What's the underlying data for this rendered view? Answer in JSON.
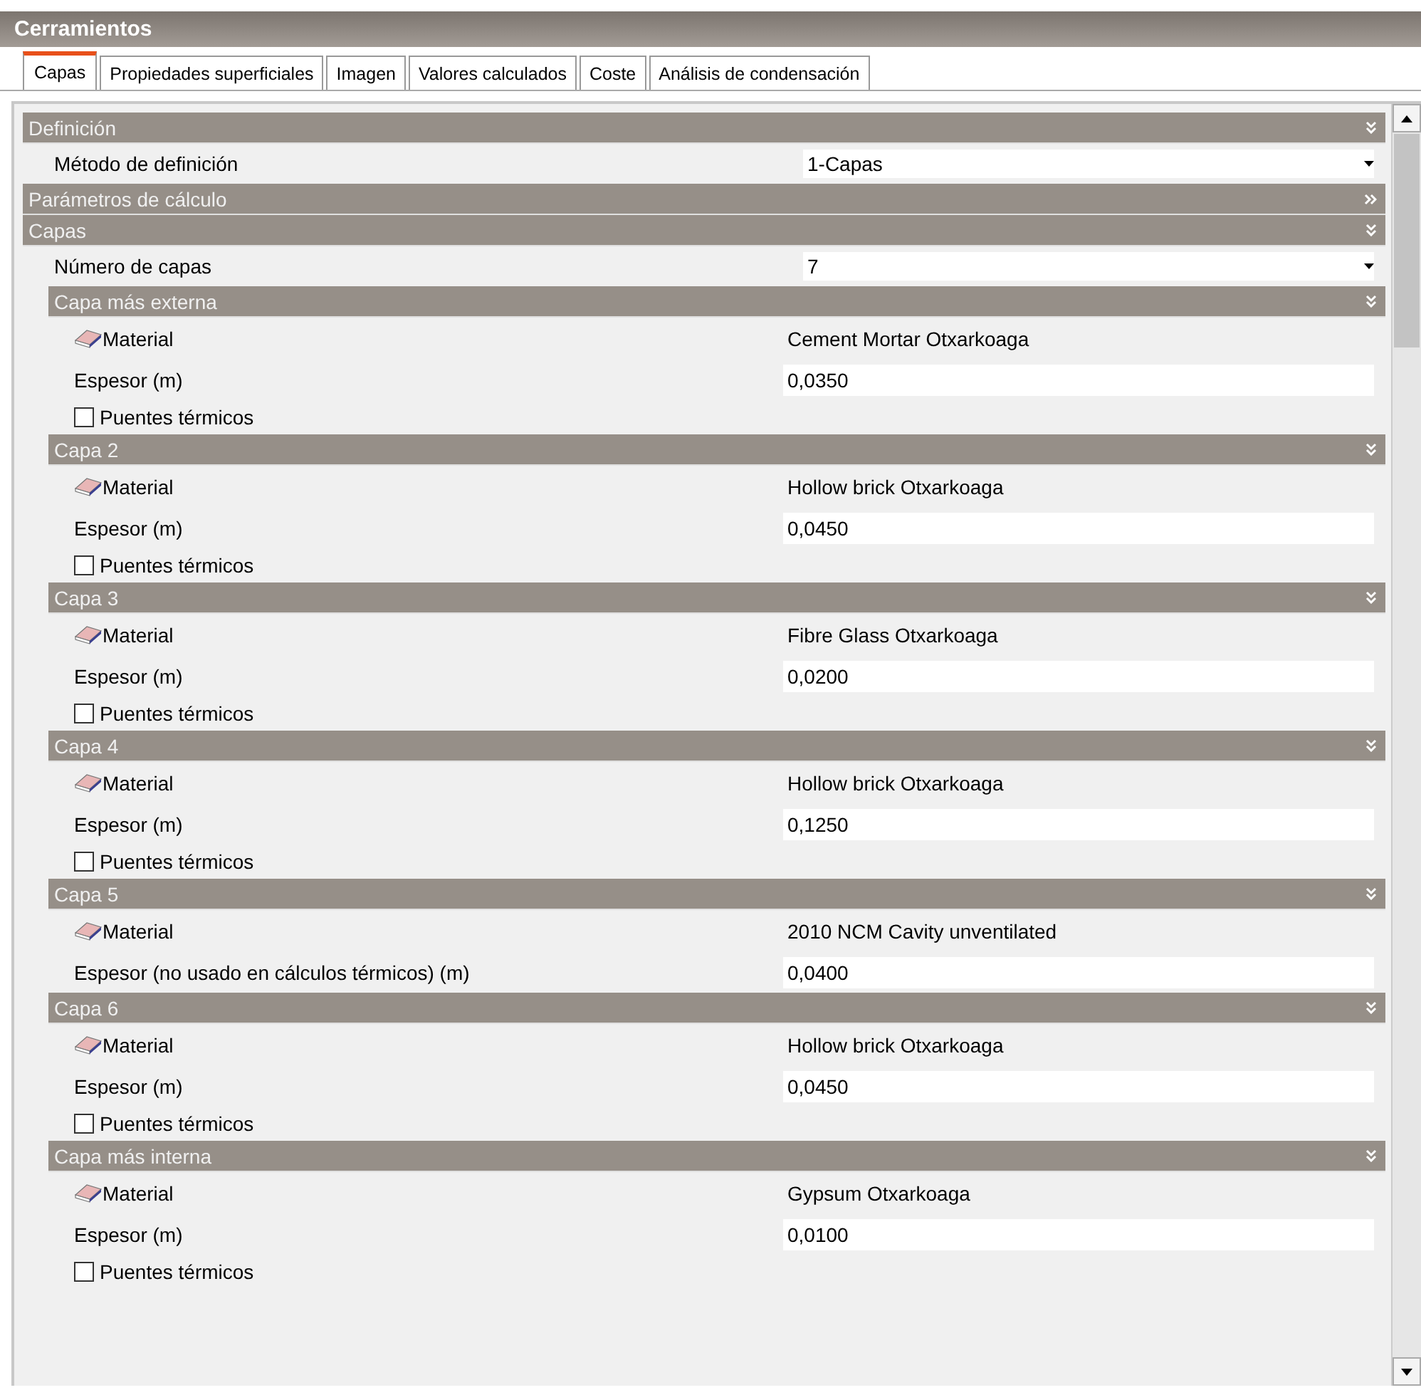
{
  "window": {
    "title": "Cerramientos"
  },
  "tabs": [
    {
      "label": "Capas",
      "selected": true
    },
    {
      "label": "Propiedades superficiales",
      "selected": false
    },
    {
      "label": "Imagen",
      "selected": false
    },
    {
      "label": "Valores calculados",
      "selected": false
    },
    {
      "label": "Coste",
      "selected": false
    },
    {
      "label": "Análisis de condensación",
      "selected": false
    }
  ],
  "sections": [
    {
      "title": "Definición",
      "expanded": true,
      "rows": [
        {
          "label": "Método de definición",
          "value": "1-Capas"
        }
      ]
    },
    {
      "title": "Parámetros de cálculo",
      "expanded": false
    },
    {
      "title": "Capas",
      "expanded": true,
      "rows": [
        {
          "label": "Número de capas",
          "value": "7"
        }
      ],
      "layers": [
        {
          "title": "Capa más externa",
          "expanded": true,
          "material": {
            "label": "Material",
            "value": "Cement Mortar Otxarkoaga"
          },
          "thickness": {
            "label": "Espesor (m)",
            "value": "0,0350"
          },
          "thermal_bridges": {
            "label": "Puentes térmicos",
            "checked": false
          }
        },
        {
          "title": "Capa 2",
          "expanded": true,
          "material": {
            "label": "Material",
            "value": "Hollow brick Otxarkoaga"
          },
          "thickness": {
            "label": "Espesor (m)",
            "value": "0,0450"
          },
          "thermal_bridges": {
            "label": "Puentes térmicos",
            "checked": false
          }
        },
        {
          "title": "Capa 3",
          "expanded": true,
          "material": {
            "label": "Material",
            "value": "Fibre Glass Otxarkoaga"
          },
          "thickness": {
            "label": "Espesor (m)",
            "value": "0,0200"
          },
          "thermal_bridges": {
            "label": "Puentes térmicos",
            "checked": false
          }
        },
        {
          "title": "Capa 4",
          "expanded": true,
          "material": {
            "label": "Material",
            "value": "Hollow brick Otxarkoaga"
          },
          "thickness": {
            "label": "Espesor (m)",
            "value": "0,1250"
          },
          "thermal_bridges": {
            "label": "Puentes térmicos",
            "checked": false
          }
        },
        {
          "title": "Capa 5",
          "expanded": true,
          "material": {
            "label": "Material",
            "value": "2010 NCM Cavity unventilated"
          },
          "thickness": {
            "label": "Espesor (no usado en cálculos térmicos) (m)",
            "value": "0,0400"
          }
        },
        {
          "title": "Capa 6",
          "expanded": true,
          "material": {
            "label": "Material",
            "value": "Hollow brick Otxarkoaga"
          },
          "thickness": {
            "label": "Espesor (m)",
            "value": "0,0450"
          },
          "thermal_bridges": {
            "label": "Puentes térmicos",
            "checked": false
          }
        },
        {
          "title": "Capa más interna",
          "expanded": true,
          "material": {
            "label": "Material",
            "value": "Gypsum Otxarkoaga"
          },
          "thickness": {
            "label": "Espesor (m)",
            "value": "0,0100"
          },
          "thermal_bridges": {
            "label": "Puentes térmicos",
            "checked": false
          }
        }
      ]
    }
  ]
}
